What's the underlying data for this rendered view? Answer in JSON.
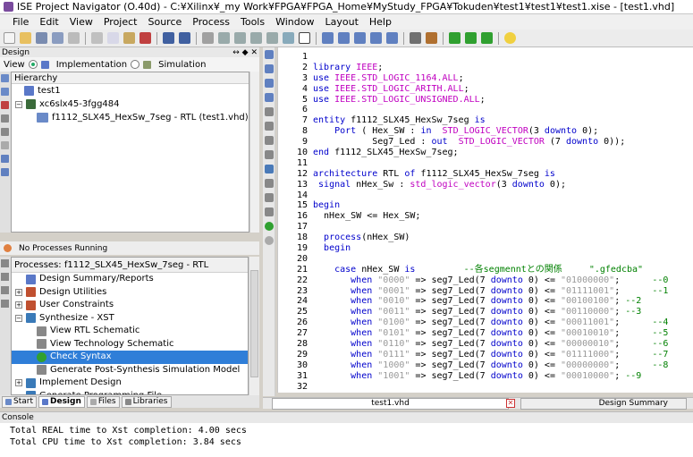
{
  "window": {
    "title": "ISE Project Navigator (O.40d) - C:¥Xilinx¥_my Work¥FPGA¥FPGA_Home¥MyStudy_FPGA¥Tokuden¥test1¥test1¥test1.xise - [test1.vhd]"
  },
  "menu": [
    "File",
    "Edit",
    "View",
    "Project",
    "Source",
    "Process",
    "Tools",
    "Window",
    "Layout",
    "Help"
  ],
  "design_panel": {
    "header": "Design",
    "header_controls": "↔ ◆ ✕",
    "view_label": "View",
    "view_implementation": "Implementation",
    "view_simulation": "Simulation",
    "hierarchy_title": "Hierarchy",
    "tree": [
      {
        "label": "test1",
        "icon": "project-icon"
      },
      {
        "label": "xc6slx45-3fgg484",
        "icon": "device-icon"
      },
      {
        "label": "f1112_SLX45_HexSw_7seg - RTL (test1.vhd)",
        "icon": "vhdl-module-icon"
      }
    ]
  },
  "process_panel": {
    "status": "No Processes Running",
    "title": "Processes: f1112_SLX45_HexSw_7seg - RTL",
    "items": [
      {
        "label": "Design Summary/Reports",
        "indent": 1,
        "expander": ""
      },
      {
        "label": "Design Utilities",
        "indent": 0,
        "expander": "+"
      },
      {
        "label": "User Constraints",
        "indent": 0,
        "expander": "+"
      },
      {
        "label": "Synthesize - XST",
        "indent": 0,
        "expander": "−"
      },
      {
        "label": "View RTL Schematic",
        "indent": 2,
        "expander": ""
      },
      {
        "label": "View Technology Schematic",
        "indent": 2,
        "expander": ""
      },
      {
        "label": "Check Syntax",
        "indent": 2,
        "expander": "",
        "selected": true
      },
      {
        "label": "Generate Post-Synthesis Simulation Model",
        "indent": 2,
        "expander": ""
      },
      {
        "label": "Implement Design",
        "indent": 0,
        "expander": "+"
      },
      {
        "label": "Generate Programming File",
        "indent": 0,
        "expander": ""
      }
    ]
  },
  "left_tabs": [
    "Start",
    "Design",
    "Files",
    "Libraries"
  ],
  "editor": {
    "line_numbers": [
      "1",
      "2",
      "3",
      "4",
      "5",
      "6",
      "7",
      "8",
      "9",
      "10",
      "11",
      "12",
      "13",
      "14",
      "15",
      "16",
      "17",
      "18",
      "19",
      "20",
      "21",
      "22",
      "23",
      "24",
      "25",
      "26",
      "27",
      "28",
      "29",
      "30",
      "31",
      "32"
    ],
    "lines": [
      "",
      "library IEEE;",
      "use IEEE.STD_LOGIC_1164.ALL;",
      "use IEEE.STD_LOGIC_ARITH.ALL;",
      "use IEEE.STD_LOGIC_UNSIGNED.ALL;",
      "",
      "entity f1112_SLX45_HexSw_7seg is",
      "    Port ( Hex_SW : in  STD_LOGIC_VECTOR(3 downto 0);",
      "           Seg7_Led : out  STD_LOGIC_VECTOR (7 downto 0));",
      "end f1112_SLX45_HexSw_7seg;",
      "",
      "architecture RTL of f1112_SLX45_HexSw_7seg is",
      " signal nHex_Sw : std_logic_vector(3 downto 0);",
      "",
      "begin",
      "  nHex_SW <= Hex_SW;",
      "",
      "  process(nHex_SW)",
      "  begin",
      "",
      "    case nHex_SW is         --各segmenntとの関係     \".gfedcba\"",
      "       when \"0000\" => seg7_Led(7 downto 0) <= \"01000000\";      --0",
      "       when \"0001\" => seg7_Led(7 downto 0) <= \"01111001\";      --1",
      "       when \"0010\" => seg7_Led(7 downto 0) <= \"00100100\"; --2",
      "       when \"0011\" => seg7_Led(7 downto 0) <= \"00110000\"; --3",
      "       when \"0100\" => seg7_Led(7 downto 0) <= \"00011001\";      --4",
      "       when \"0101\" => seg7_Led(7 downto 0) <= \"00010010\";      --5",
      "       when \"0110\" => seg7_Led(7 downto 0) <= \"00000010\";      --6",
      "       when \"0111\" => seg7_Led(7 downto 0) <= \"01111000\";      --7",
      "       when \"1000\" => seg7_Led(7 downto 0) <= \"00000000\";      --8",
      "       when \"1001\" => seg7_Led(7 downto 0) <= \"00010000\"; --9",
      ""
    ],
    "tab_file": "test1.vhd",
    "tab_summary": "Design Summary"
  },
  "console": {
    "header": "Console",
    "lines": [
      "Total REAL time to Xst completion: 4.00 secs",
      "Total CPU time to Xst completion: 3.84 secs"
    ]
  },
  "colors": {
    "keyword": "#0000cc",
    "type": "#c000c0",
    "string": "#999999",
    "comment": "#008000",
    "selection": "#2f7ed8"
  }
}
